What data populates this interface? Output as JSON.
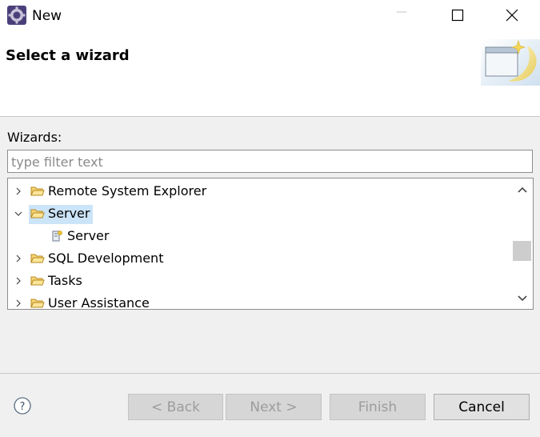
{
  "window": {
    "title": "New",
    "icon": "eclipse-gear-icon",
    "controls": [
      "minimize-icon",
      "maximize-icon",
      "close-icon"
    ]
  },
  "banner": {
    "title": "Select a wizard",
    "image": "wizard-banner-icon"
  },
  "wizards": {
    "label": "Wizards:",
    "filter_placeholder": "type filter text",
    "filter_value": "",
    "tree": [
      {
        "label": "Remote System Explorer",
        "expanded": false,
        "icon": "folder-icon"
      },
      {
        "label": "Server",
        "expanded": true,
        "selected": true,
        "icon": "folder-icon"
      },
      {
        "label": "Server",
        "leaf": true,
        "icon": "server-wizard-icon"
      },
      {
        "label": "SQL Development",
        "expanded": false,
        "icon": "folder-icon"
      },
      {
        "label": "Tasks",
        "expanded": false,
        "icon": "folder-icon"
      },
      {
        "label": "User Assistance",
        "expanded": false,
        "icon": "folder-icon"
      }
    ]
  },
  "buttons": {
    "back": "< Back",
    "next": "Next >",
    "finish": "Finish",
    "cancel": "Cancel"
  },
  "colors": {
    "selection": "#cce4f7",
    "folder": "#e8b84a",
    "disabled_text": "#9c9c9c"
  }
}
